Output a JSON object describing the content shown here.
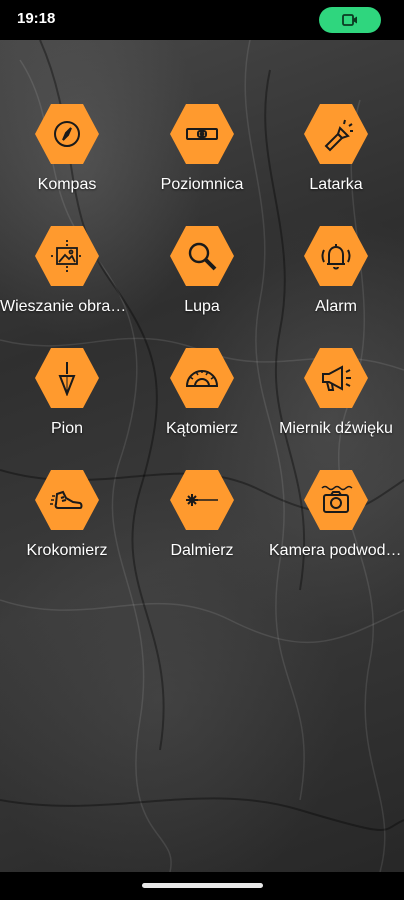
{
  "status_bar": {
    "time": "19:18",
    "recording_icon": "video-camera-icon"
  },
  "tools": [
    {
      "label": "Kompas",
      "icon": "compass-icon"
    },
    {
      "label": "Poziomnica",
      "icon": "spirit-level-icon"
    },
    {
      "label": "Latarka",
      "icon": "flashlight-icon"
    },
    {
      "label": "Wieszanie obrazów",
      "icon": "picture-hanging-icon"
    },
    {
      "label": "Lupa",
      "icon": "magnifier-icon"
    },
    {
      "label": "Alarm",
      "icon": "alarm-bell-icon"
    },
    {
      "label": "Pion",
      "icon": "plumb-bob-icon"
    },
    {
      "label": "Kątomierz",
      "icon": "protractor-icon"
    },
    {
      "label": "Miernik dźwięku",
      "icon": "megaphone-icon"
    },
    {
      "label": "Krokomierz",
      "icon": "running-shoe-icon"
    },
    {
      "label": "Dalmierz",
      "icon": "laser-rangefinder-icon"
    },
    {
      "label": "Kamera podwodna",
      "icon": "underwater-camera-icon"
    }
  ],
  "colors": {
    "accent": "#ff9a2e",
    "icon_stroke": "#1a1a1a",
    "pill": "#2fd67e",
    "label": "#ffffff"
  }
}
